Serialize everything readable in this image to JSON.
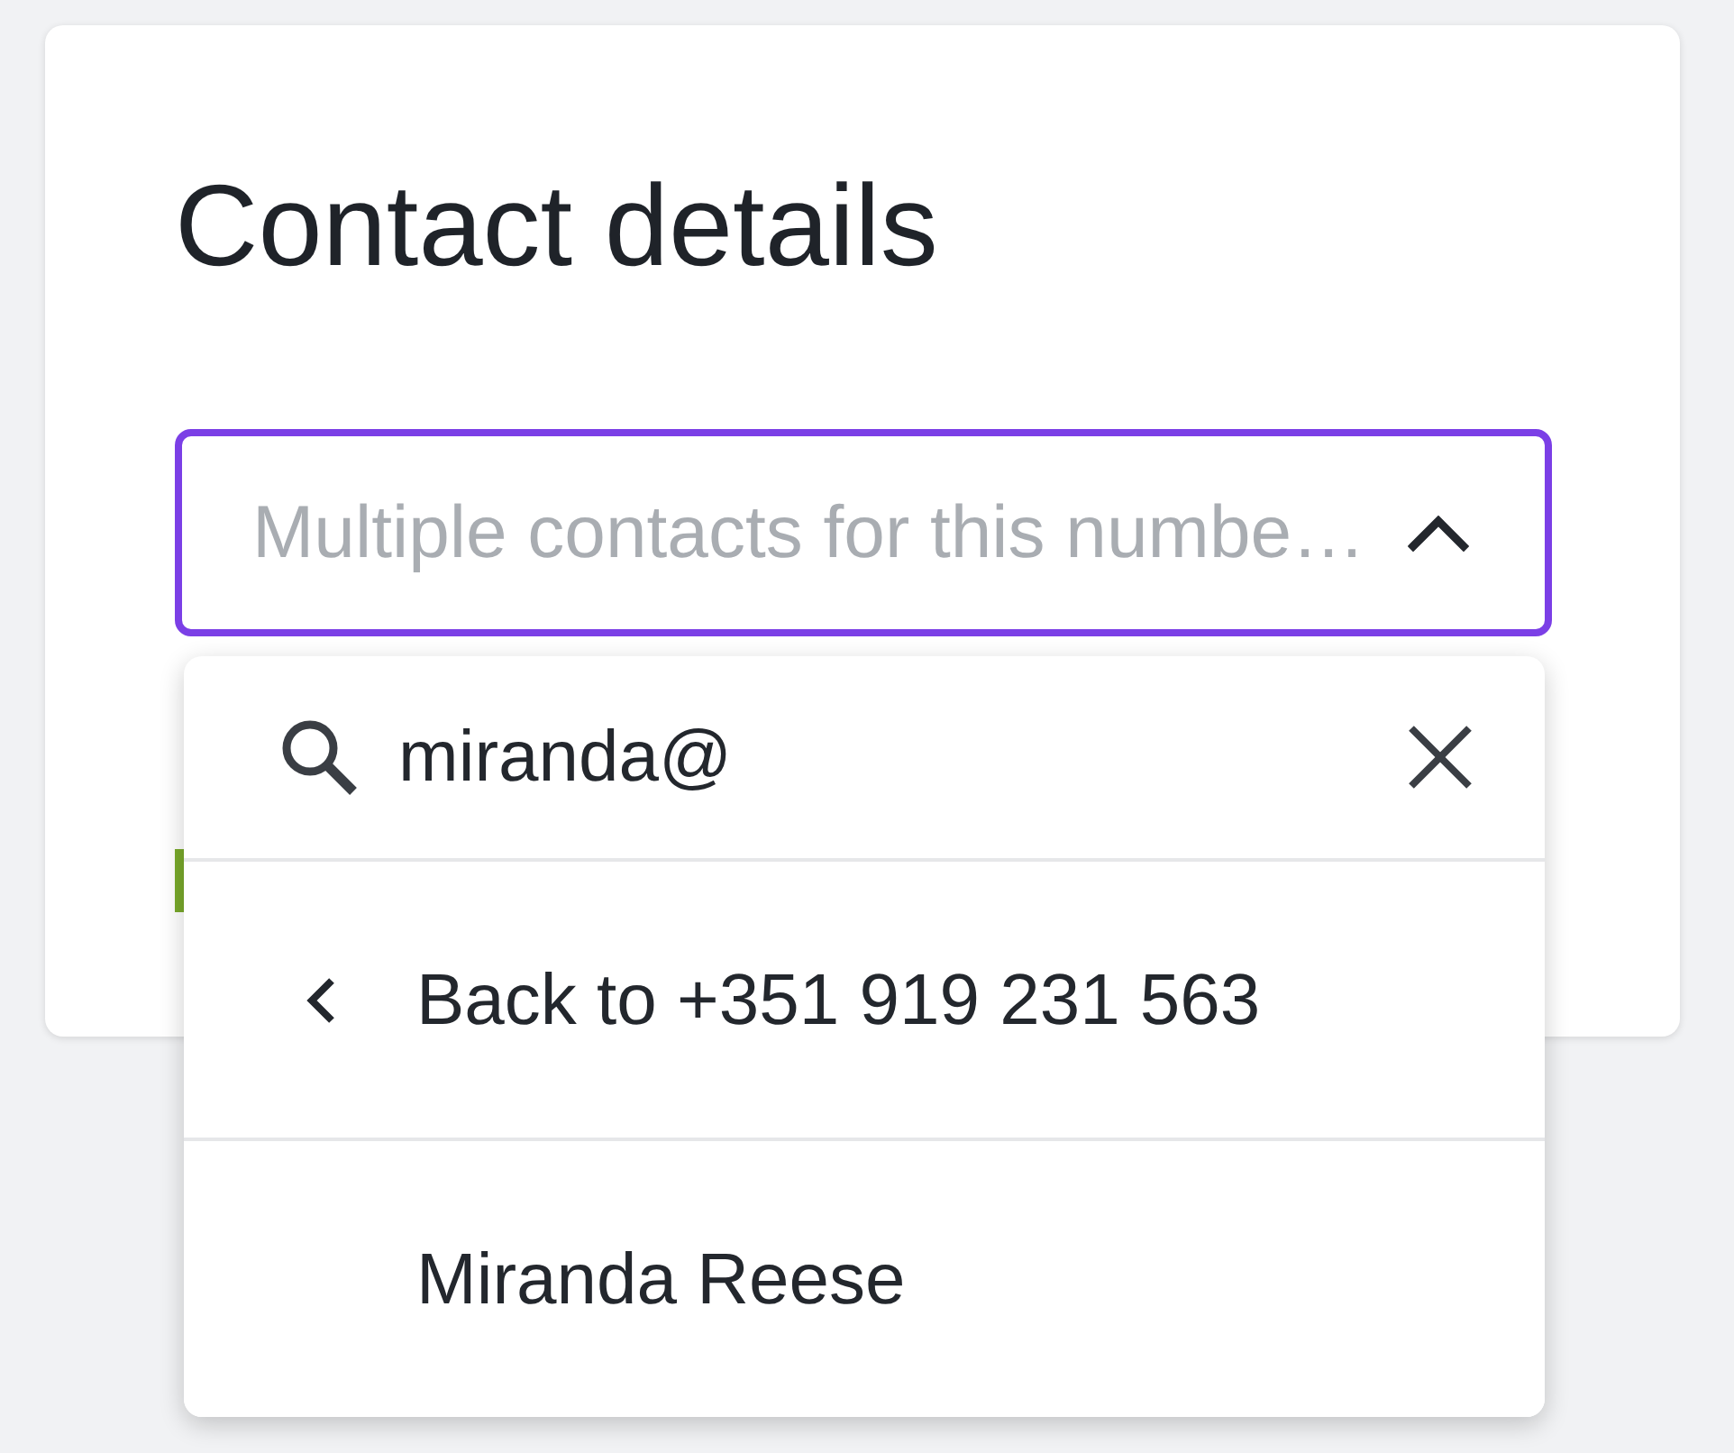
{
  "card": {
    "title": "Contact details"
  },
  "contact_select": {
    "placeholder": "Multiple contacts for this numbe…",
    "expanded": true
  },
  "dropdown": {
    "search": {
      "value": "miranda@"
    },
    "back_item": {
      "label": "Back to +351 919 231 563"
    },
    "options": [
      {
        "label": "Miranda Reese",
        "selected": false
      }
    ]
  }
}
